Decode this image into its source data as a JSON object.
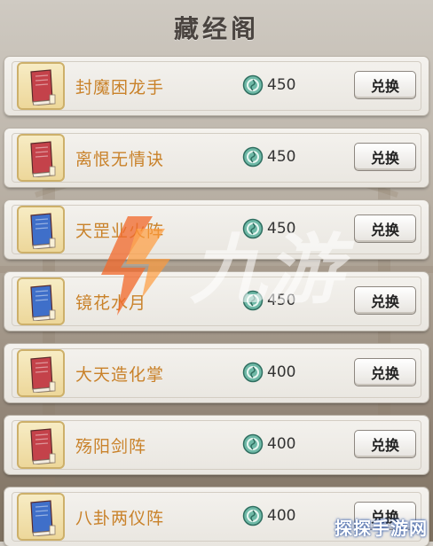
{
  "header": {
    "title": "藏经阁"
  },
  "currency_icon": "jade-coin-icon",
  "button_label": "兑换",
  "items": [
    {
      "name": "封魔困龙手",
      "price": "450",
      "book_color": "#c4424a",
      "book_icon": "red-book-icon"
    },
    {
      "name": "离恨无情诀",
      "price": "450",
      "book_color": "#c4424a",
      "book_icon": "red-book-icon"
    },
    {
      "name": "天罡业火阵",
      "price": "450",
      "book_color": "#3f6fc9",
      "book_icon": "blue-book-icon"
    },
    {
      "name": "镜花水月",
      "price": "450",
      "book_color": "#3f6fc9",
      "book_icon": "blue-book-icon"
    },
    {
      "name": "大天造化掌",
      "price": "400",
      "book_color": "#c4424a",
      "book_icon": "red-book-icon"
    },
    {
      "name": "殇阳剑阵",
      "price": "400",
      "book_color": "#c4424a",
      "book_icon": "red-book-icon"
    },
    {
      "name": "八卦两仪阵",
      "price": "400",
      "book_color": "#3f6fc9",
      "book_icon": "blue-book-icon"
    }
  ],
  "watermark": {
    "logo_text": "九游",
    "corner_text": "探探手游网"
  }
}
